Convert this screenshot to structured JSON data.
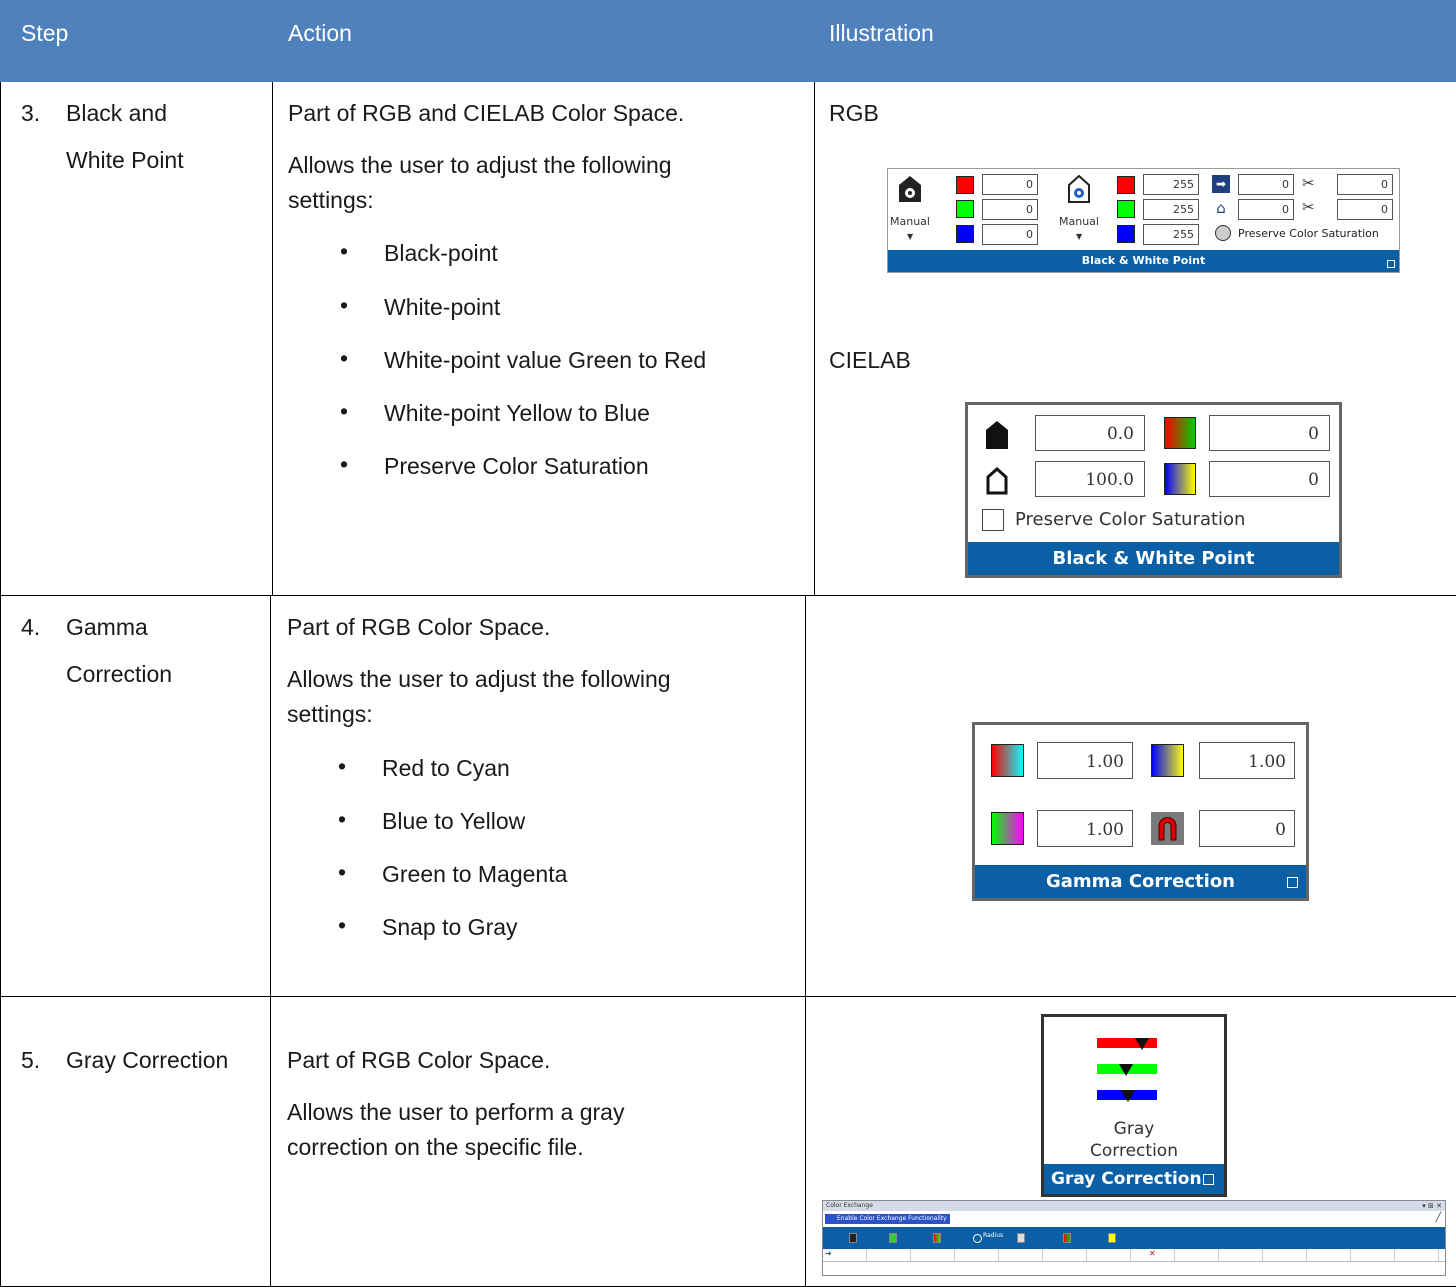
{
  "header": {
    "step": "Step",
    "action": "Action",
    "illustration": "Illustration"
  },
  "rows": [
    {
      "num": "3.",
      "step_lines": [
        "Black and",
        "White Point"
      ],
      "action_intro": "Part of RGB and CIELAB Color Space.",
      "action_lines": [
        "Allows the user to adjust the following",
        "settings:"
      ],
      "bullets": [
        "Black-point",
        "White-point",
        "White-point value Green to Red",
        "White-point Yellow to Blue",
        "Preserve Color Saturation"
      ],
      "label_rgb": "RGB",
      "label_cielab": "CIELAB"
    },
    {
      "num": "4.",
      "step_lines": [
        "Gamma",
        "Correction"
      ],
      "action_intro": "Part of RGB Color Space.",
      "action_lines": [
        "Allows the user to adjust the following",
        "settings:"
      ],
      "bullets": [
        "Red to Cyan",
        "Blue to Yellow",
        "Green to Magenta",
        "Snap to Gray"
      ]
    },
    {
      "num": "5.",
      "step_lines": [
        "Gray Correction"
      ],
      "action_intro": "Part of RGB Color Space.",
      "action_lines": [
        "Allows the user to perform a gray",
        "correction on the specific file."
      ]
    }
  ],
  "rgb_panel": {
    "black_mode": "Manual",
    "white_mode": "Manual",
    "black_r": "0",
    "black_g": "0",
    "black_b": "0",
    "white_r": "255",
    "white_g": "255",
    "white_b": "255",
    "arrow_val": "0",
    "home_val": "0",
    "cut1_val": "0",
    "cut2_val": "0",
    "preserve_label": "Preserve Color Saturation",
    "title": "Black & White Point"
  },
  "cielab_panel": {
    "black_val": "0.0",
    "white_val": "100.0",
    "green_red_val": "0",
    "yellow_blue_val": "0",
    "preserve_label": "Preserve Color Saturation",
    "title": "Black & White Point"
  },
  "gamma_panel": {
    "red_cyan": "1.00",
    "blue_yellow": "1.00",
    "green_magenta": "1.00",
    "snap_gray": "0",
    "title": "Gamma Correction"
  },
  "gray_panel": {
    "button_line1": "Gray",
    "button_line2": "Correction",
    "title": "Gray Correction"
  },
  "color_exchange": {
    "window_title": "Color Exchange",
    "enable_label": "Enable Color Exchange Functionality",
    "radius_label": "Radius"
  },
  "colors": {
    "header_bg": "#4f81bd",
    "ribbon_bar": "#0b5fa5"
  }
}
